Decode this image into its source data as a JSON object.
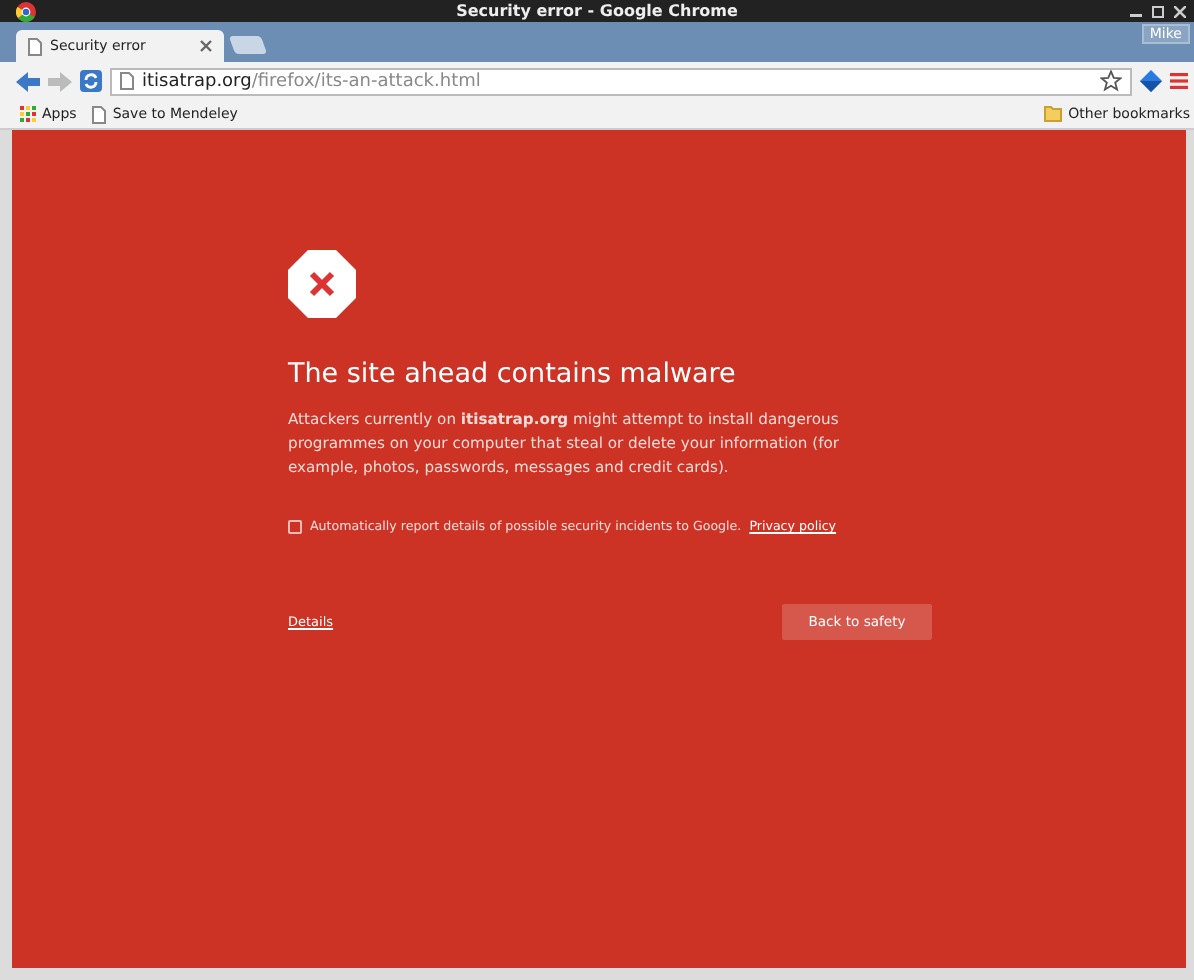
{
  "window": {
    "title": "Security error - Google Chrome"
  },
  "tabs": [
    {
      "label": "Security error",
      "selected": true
    }
  ],
  "profile": {
    "name": "Mike"
  },
  "address_bar": {
    "host": "itisatrap.org",
    "path": "/firefox/its-an-attack.html"
  },
  "bookmarks": [
    {
      "label": "Apps",
      "kind": "apps"
    },
    {
      "label": "Save to Mendeley",
      "kind": "page"
    }
  ],
  "other_bookmarks": "Other bookmarks",
  "interstitial": {
    "heading": "The site ahead contains malware",
    "message": "Attackers currently on **itisatrap.org** might attempt to install dangerous programmes on your computer that steal or delete your information (for example, photos, passwords, messages and credit cards).",
    "report_checkbox": {
      "label": "Automatically report details of possible security incidents to Google.",
      "checked": false
    },
    "privacy_link": "Privacy policy",
    "details_link": "Details",
    "back_button": "Back to safety"
  }
}
